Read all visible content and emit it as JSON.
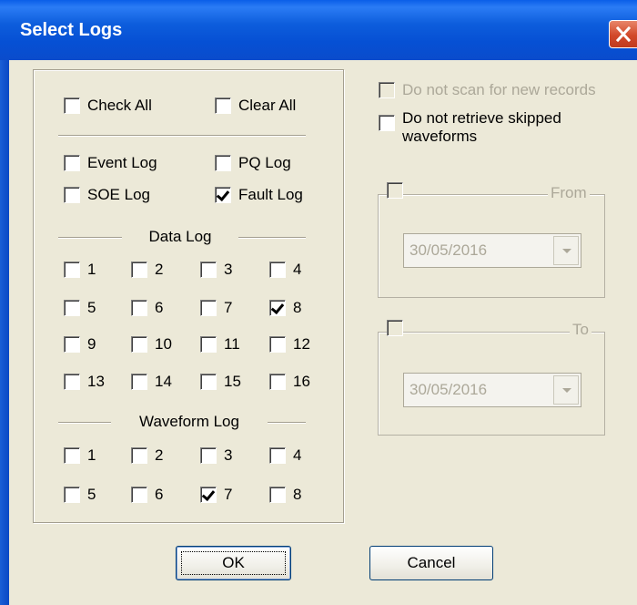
{
  "window": {
    "title": "Select Logs"
  },
  "top": {
    "check_all": "Check All",
    "clear_all": "Clear All"
  },
  "logs": {
    "event": "Event Log",
    "pq": "PQ Log",
    "soe": "SOE Log",
    "fault": "Fault Log",
    "fault_checked": true
  },
  "data_log": {
    "title": "Data Log",
    "items": [
      "1",
      "2",
      "3",
      "4",
      "5",
      "6",
      "7",
      "8",
      "9",
      "10",
      "11",
      "12",
      "13",
      "14",
      "15",
      "16"
    ],
    "checked": [
      "8"
    ]
  },
  "waveform_log": {
    "title": "Waveform Log",
    "items": [
      "1",
      "2",
      "3",
      "4",
      "5",
      "6",
      "7",
      "8"
    ],
    "checked": [
      "7"
    ]
  },
  "options": {
    "no_scan": "Do not scan for new records",
    "no_retrieve_1": "Do not retrieve skipped",
    "no_retrieve_2": "waveforms"
  },
  "from": {
    "label": "From",
    "date": "30/05/2016"
  },
  "to": {
    "label": "To",
    "date": "30/05/2016"
  },
  "buttons": {
    "ok": "OK",
    "cancel": "Cancel"
  }
}
